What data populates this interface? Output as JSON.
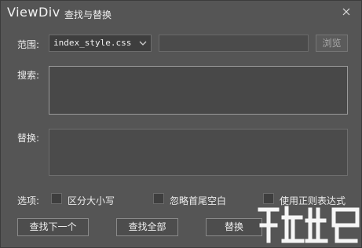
{
  "title": {
    "app": "ViewDiv",
    "subtitle": "查找与替换"
  },
  "scope": {
    "label": "范围:",
    "selected": "index_style.css",
    "path_value": "",
    "browse_label": "浏览"
  },
  "search": {
    "label": "搜索:",
    "value": ""
  },
  "replace": {
    "label": "替换:",
    "value": ""
  },
  "options": {
    "label": "选项:",
    "items": [
      {
        "label": "区分大小写",
        "checked": false
      },
      {
        "label": "忽略首尾空白",
        "checked": false
      },
      {
        "label": "使用正则表达式",
        "checked": false
      }
    ]
  },
  "buttons": {
    "find_next": "查找下一个",
    "find_all": "查找全部",
    "replace": "替换"
  },
  "icons": {
    "close": "close-icon",
    "dropdown": "chevron-down-icon",
    "watermark": "watermark-logo"
  }
}
